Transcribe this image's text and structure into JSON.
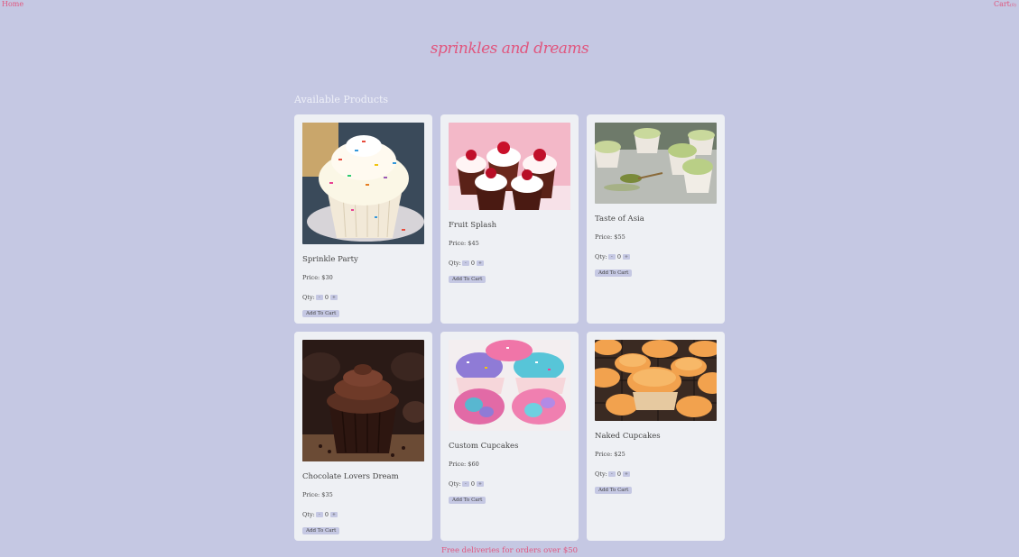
{
  "nav": {
    "home_label": "Home",
    "cart_label": "Cart",
    "cart_count": "(0)"
  },
  "brand": {
    "title": "sprinkles and dreams"
  },
  "section_title": "Available Products",
  "products": [
    {
      "name": "Sprinkle Party",
      "price": "Price: $30",
      "qty_label": "Qty:",
      "qty": "0",
      "add_label": "Add To Cart",
      "image": "vanilla-sprinkle-cupcake-photo"
    },
    {
      "name": "Fruit Splash",
      "price": "Price: $45",
      "qty_label": "Qty:",
      "qty": "0",
      "add_label": "Add To Cart",
      "image": "cherry-chocolate-cupcakes-photo"
    },
    {
      "name": "Taste of Asia",
      "price": "Price: $55",
      "qty_label": "Qty:",
      "qty": "0",
      "add_label": "Add To Cart",
      "image": "matcha-cupcakes-photo"
    },
    {
      "name": "Chocolate Lovers Dream",
      "price": "Price: $35",
      "qty_label": "Qty:",
      "qty": "0",
      "add_label": "Add To Cart",
      "image": "chocolate-cupcake-photo"
    },
    {
      "name": "Custom Cupcakes",
      "price": "Price: $60",
      "qty_label": "Qty:",
      "qty": "0",
      "add_label": "Add To Cart",
      "image": "colorful-custom-cupcakes-photo"
    },
    {
      "name": "Naked Cupcakes",
      "price": "Price: $25",
      "qty_label": "Qty:",
      "qty": "0",
      "add_label": "Add To Cart",
      "image": "plain-cupcakes-photo"
    }
  ],
  "qty_controls": {
    "minus": "-",
    "plus": "+"
  },
  "footer": {
    "note": "Free deliveries for orders over $50"
  },
  "colors": {
    "background": "#c5c8e3",
    "accent": "#e0577f",
    "card": "#eef0f4"
  }
}
